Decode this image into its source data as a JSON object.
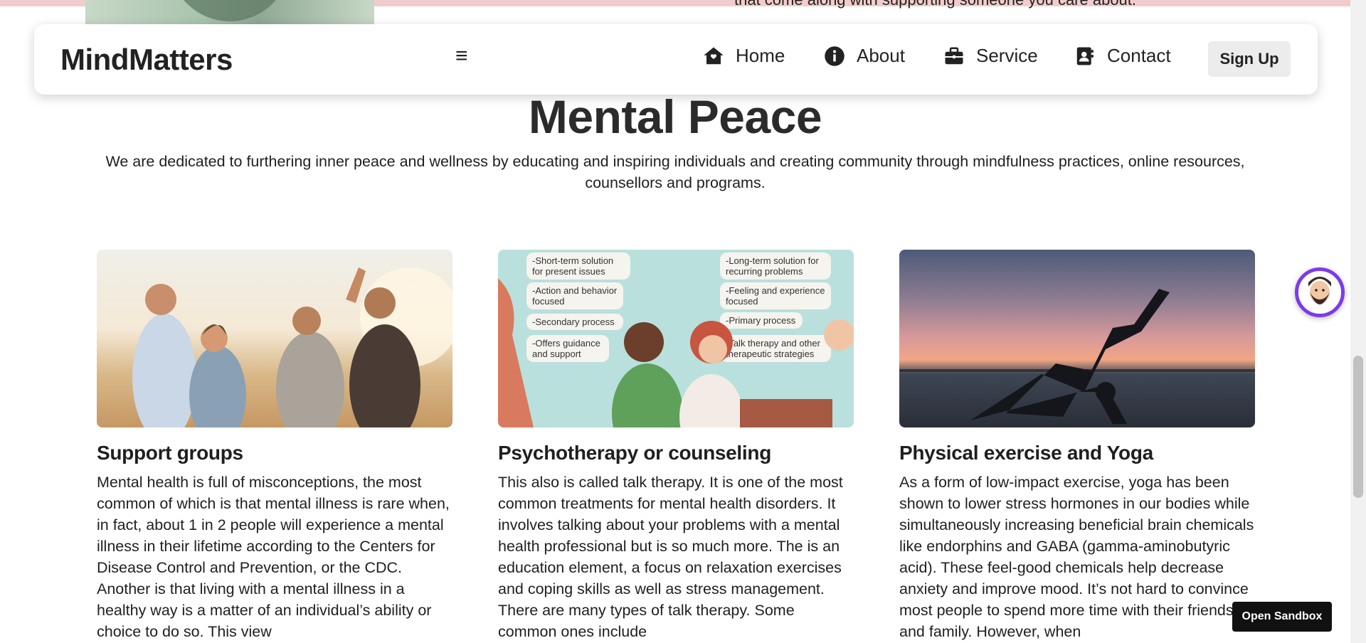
{
  "prev_section": {
    "text_fragment": "that come along with supporting someone you care about."
  },
  "navbar": {
    "brand": "MindMatters",
    "menu_icon": "hamburger-menu-icon",
    "items": [
      {
        "label": "Home",
        "icon": "house-icon"
      },
      {
        "label": "About",
        "icon": "info-circle-icon"
      },
      {
        "label": "Service",
        "icon": "briefcase-icon"
      },
      {
        "label": "Contact",
        "icon": "address-card-icon"
      }
    ],
    "signup_label": "Sign Up"
  },
  "hero": {
    "title": "Mental Peace",
    "subtitle": "We are dedicated to furthering inner peace and wellness by educating and inspiring individuals and creating community through mindfulness practices, online resources, counsellors and programs."
  },
  "cards": [
    {
      "title": "Support groups",
      "text": "Mental health is full of misconceptions, the most common of which is that mental illness is rare when, in fact, about 1 in 2 people will experience a mental illness in their lifetime according to the Centers for Disease Control and Prevention, or the CDC. Another is that living with a mental illness in a healthy way is a matter of an individual’s ability or choice to do so. This view"
    },
    {
      "title": "Psychotherapy or counseling",
      "text": "This also is called talk therapy. It is one of the most common treatments for mental health disorders. It involves talking about your problems with a mental health professional but is so much more. The is an education element, a focus on relaxation exercises and coping skills as well as stress management. There are many types of talk therapy. Some common ones include",
      "image_bubbles_left": [
        "-Short-term solution for present issues",
        "-Action and behavior focused",
        "-Secondary process",
        "-Offers guidance and support"
      ],
      "image_bubbles_right": [
        "-Long-term solution for recurring problems",
        "-Feeling and experience focused",
        "-Primary process",
        "-Talk therapy and other therapeutic strategies"
      ]
    },
    {
      "title": "Physical exercise and Yoga",
      "text": "As a form of low-impact exercise, yoga has been shown to lower stress hormones in our bodies while simultaneously increasing beneficial brain chemicals like endorphins and GABA (gamma-aminobutyric acid). These feel-good chemicals help decrease anxiety and improve mood. It’s not hard to convince most people to spend more time with their friends and family. However, when"
    }
  ],
  "widgets": {
    "chat_avatar_icon": "bearded-man-avatar-icon",
    "open_sandbox_label": "Open Sandbox"
  },
  "colors": {
    "accent_purple": "#7c3aed",
    "text_dark": "#1f1f1f",
    "signup_bg": "#ececec",
    "sandbox_bg": "#111111"
  }
}
